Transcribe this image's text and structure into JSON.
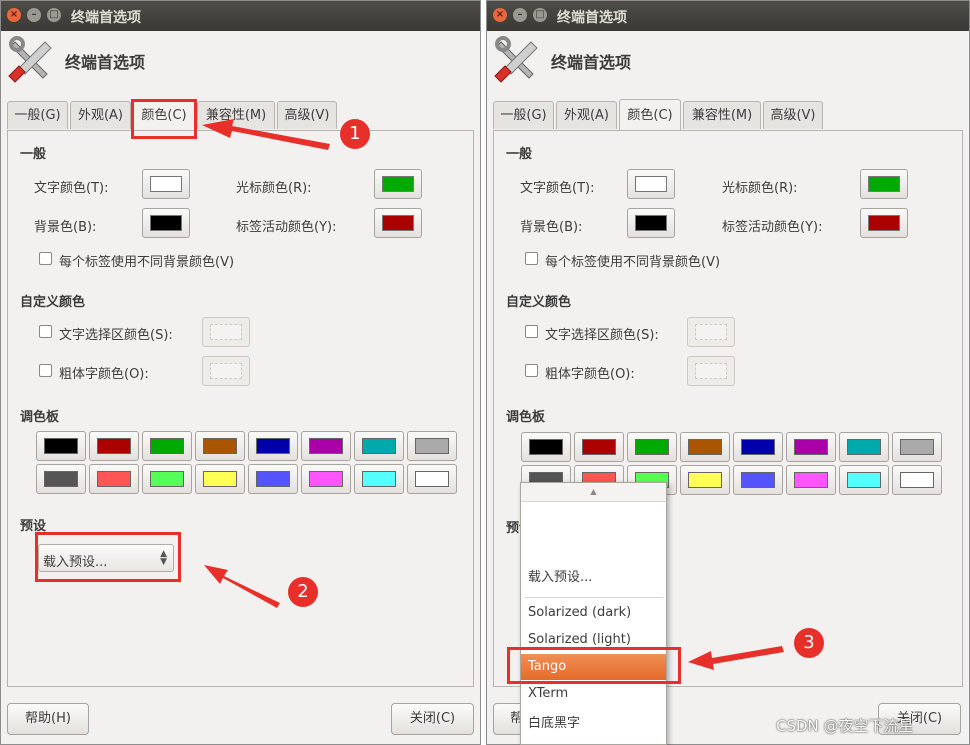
{
  "window": {
    "title": "终端首选项",
    "header_title": "终端首选项",
    "tabs": [
      "一般(G)",
      "外观(A)",
      "颜色(C)",
      "兼容性(M)",
      "高级(V)"
    ],
    "active_tab": "颜色(C)"
  },
  "general": {
    "heading": "一般",
    "text_color_label": "文字颜色(T):",
    "text_color": "#ffffff",
    "cursor_color_label": "光标颜色(R):",
    "cursor_color": "#00aa00",
    "bg_color_label": "背景色(B):",
    "bg_color": "#000000",
    "active_tab_color_label": "标签活动颜色(Y):",
    "active_tab_color": "#aa0000",
    "per_tab_bg_label": "每个标签使用不同背景颜色(V)"
  },
  "custom": {
    "heading": "自定义颜色",
    "selection_label": "文字选择区颜色(S):",
    "bold_label": "粗体字颜色(O):"
  },
  "palette": {
    "heading": "调色板",
    "colors": [
      "#000000",
      "#aa0000",
      "#00aa00",
      "#aa5500",
      "#0000aa",
      "#aa00aa",
      "#00aaaa",
      "#aaaaaa",
      "#555555",
      "#ff5555",
      "#55ff55",
      "#ffff55",
      "#5555ff",
      "#ff55ff",
      "#55ffff",
      "#ffffff"
    ]
  },
  "presets": {
    "heading": "预设",
    "combo_value": "载入预设...",
    "menu": {
      "items": [
        "载入预设...",
        "Solarized (dark)",
        "Solarized (light)",
        "Tango",
        "XTerm",
        "白底黑字"
      ],
      "selected": "Tango"
    }
  },
  "buttons": {
    "help": "帮助(H)",
    "help_partial": "帮",
    "close": "关闭(C)"
  },
  "annotations": {
    "step1": "1",
    "step2": "2",
    "step3": "3",
    "accent": "#e8302b"
  },
  "watermark": "CSDN @夜空下流星"
}
